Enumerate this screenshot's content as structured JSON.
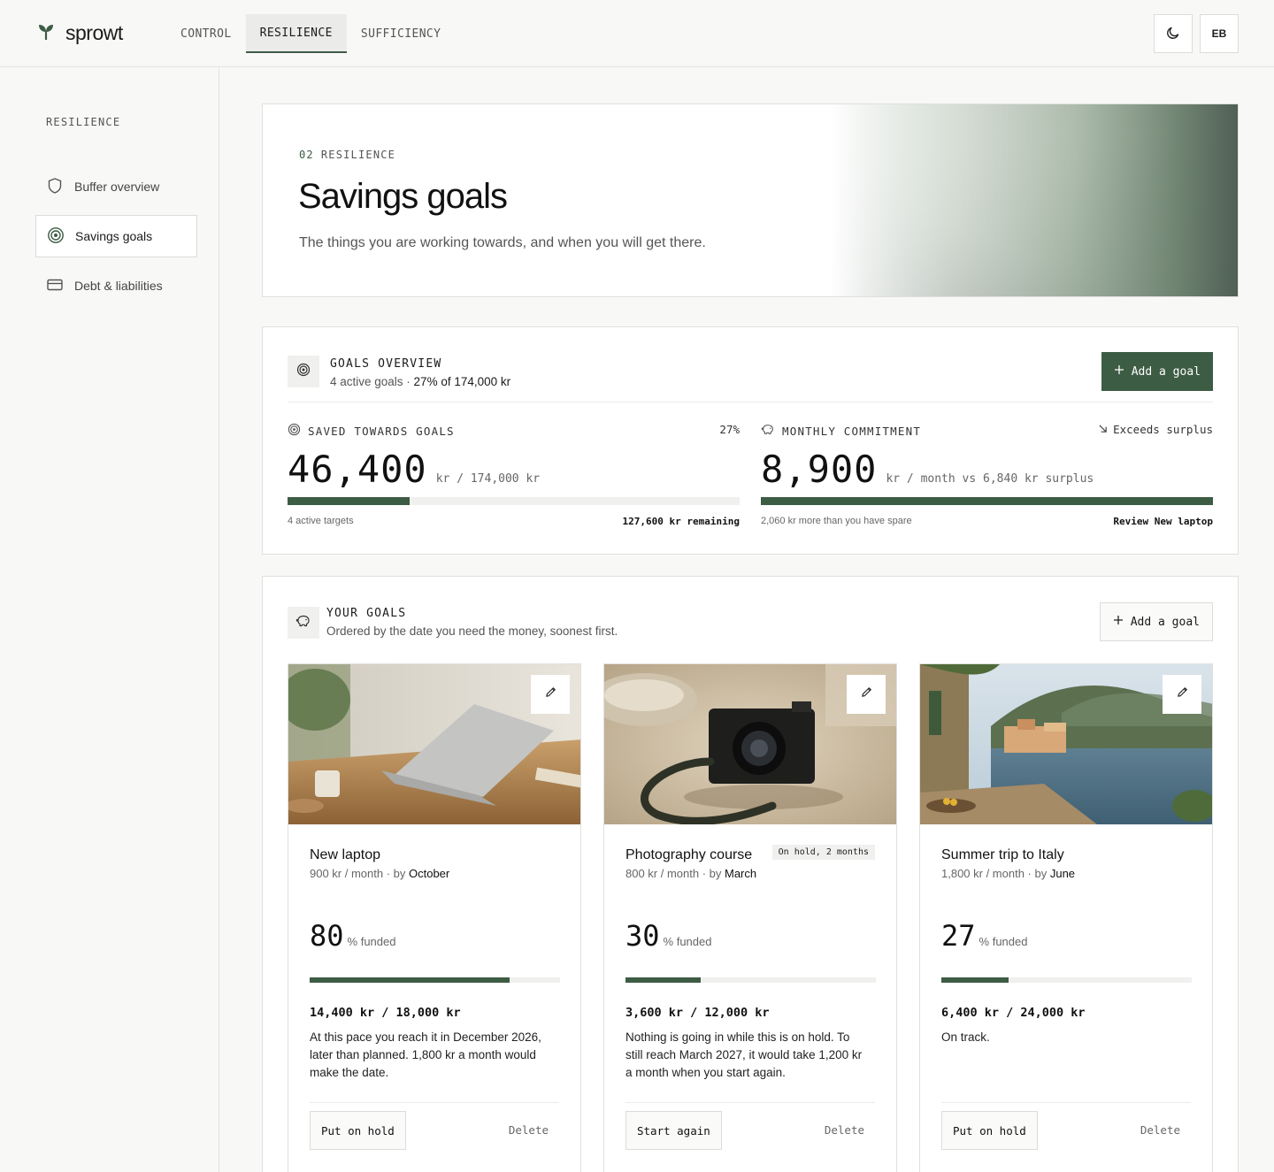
{
  "header": {
    "brand": "sprowt",
    "tabs": [
      {
        "label": "CONTROL",
        "active": false
      },
      {
        "label": "RESILIENCE",
        "active": true
      },
      {
        "label": "SUFFICIENCY",
        "active": false
      }
    ],
    "avatar_initials": "EB",
    "theme_icon": "moon-icon"
  },
  "sidebar": {
    "heading": "RESILIENCE",
    "items": [
      {
        "label": "Buffer overview",
        "icon": "shield-icon",
        "active": false
      },
      {
        "label": "Savings goals",
        "icon": "target-icon",
        "active": true
      },
      {
        "label": "Debt & liabilities",
        "icon": "card-icon",
        "active": false
      }
    ]
  },
  "hero": {
    "number": "02",
    "section": "RESILIENCE",
    "title": "Savings goals",
    "subtitle": "The things you are working towards, and when you will get there."
  },
  "overview": {
    "title": "GOALS OVERVIEW",
    "sub_prefix": "4 active goals · ",
    "sub_strong": "27% of 174,000 kr",
    "add_label": "Add a goal",
    "saved": {
      "label": "SAVED TOWARDS GOALS",
      "percent_label": "27%",
      "value": "46,400",
      "unit": "kr  / 174,000 kr",
      "progress": 0.27,
      "foot_left": "4 active targets",
      "foot_right": "127,600 kr remaining"
    },
    "monthly": {
      "label": "MONTHLY COMMITMENT",
      "status": "Exceeds surplus",
      "value": "8,900",
      "unit": "kr / month  vs 6,840 kr surplus",
      "progress": 1.0,
      "foot_left": "2,060 kr more than you have spare",
      "foot_right": "Review New laptop"
    }
  },
  "your_goals": {
    "title": "YOUR GOALS",
    "subtitle": "Ordered by the date you need the money, soonest first.",
    "add_label": "Add a goal",
    "goals": [
      {
        "name": "New laptop",
        "meta_prefix": "900 kr / month · by ",
        "meta_date": "October",
        "badge": "",
        "pct": "80",
        "pct_unit": "% funded",
        "progress": 0.8,
        "amount": "14,400 kr / 18,000 kr",
        "note": "At this pace you reach it in December 2026, later than planned. 1,800 kr a month would make the date.",
        "action": "Put on hold",
        "delete": "Delete"
      },
      {
        "name": "Photography course",
        "meta_prefix": "800 kr / month · by ",
        "meta_date": "March",
        "badge": "On hold, 2 months",
        "pct": "30",
        "pct_unit": "% funded",
        "progress": 0.3,
        "amount": "3,600 kr / 12,000 kr",
        "note": "Nothing is going in while this is on hold. To still reach March 2027, it would take 1,200 kr a month when you start again.",
        "action": "Start again",
        "delete": "Delete"
      },
      {
        "name": "Summer trip to Italy",
        "meta_prefix": "1,800 kr / month · by ",
        "meta_date": "June",
        "badge": "",
        "pct": "27",
        "pct_unit": "% funded",
        "progress": 0.27,
        "amount": "6,400 kr / 24,000 kr",
        "note": "On track.",
        "action": "Put on hold",
        "delete": "Delete"
      }
    ]
  },
  "colors": {
    "accent": "#3d5c44",
    "background": "#f8f8f7"
  }
}
